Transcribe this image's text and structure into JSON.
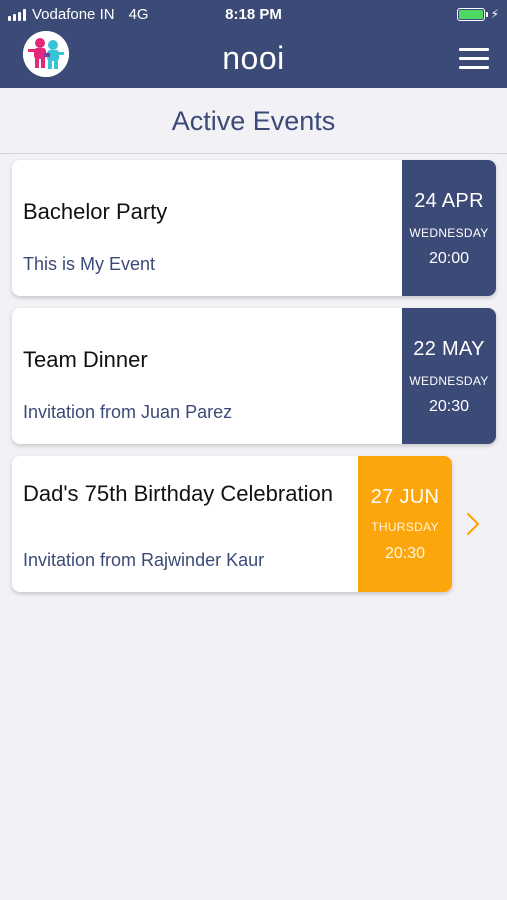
{
  "status_bar": {
    "carrier": "Vodafone IN",
    "network": "4G",
    "time": "8:18 PM"
  },
  "header": {
    "app_title": "nooi",
    "logo_icon": "nooi-logo-icon",
    "menu_icon": "hamburger-menu-icon"
  },
  "page": {
    "title": "Active Events"
  },
  "events": [
    {
      "title": "Bachelor Party",
      "subtitle": "This is My Event",
      "date": "24 APR",
      "weekday": "WEDNESDAY",
      "time": "20:00",
      "color": "#3c4a78"
    },
    {
      "title": "Team Dinner",
      "subtitle": "Invitation from Juan  Parez",
      "date": "22 MAY",
      "weekday": "WEDNESDAY",
      "time": "20:30",
      "color": "#3c4a78"
    },
    {
      "title": "Dad's 75th Birthday Celebration",
      "subtitle": "Invitation from Rajwinder  Kaur",
      "date": "27 JUN",
      "weekday": "THURSDAY",
      "time": "20:30",
      "color": "#fca60b"
    }
  ],
  "colors": {
    "primary": "#3c4a78",
    "accent": "#fca60b",
    "background": "#f1f1f6"
  }
}
